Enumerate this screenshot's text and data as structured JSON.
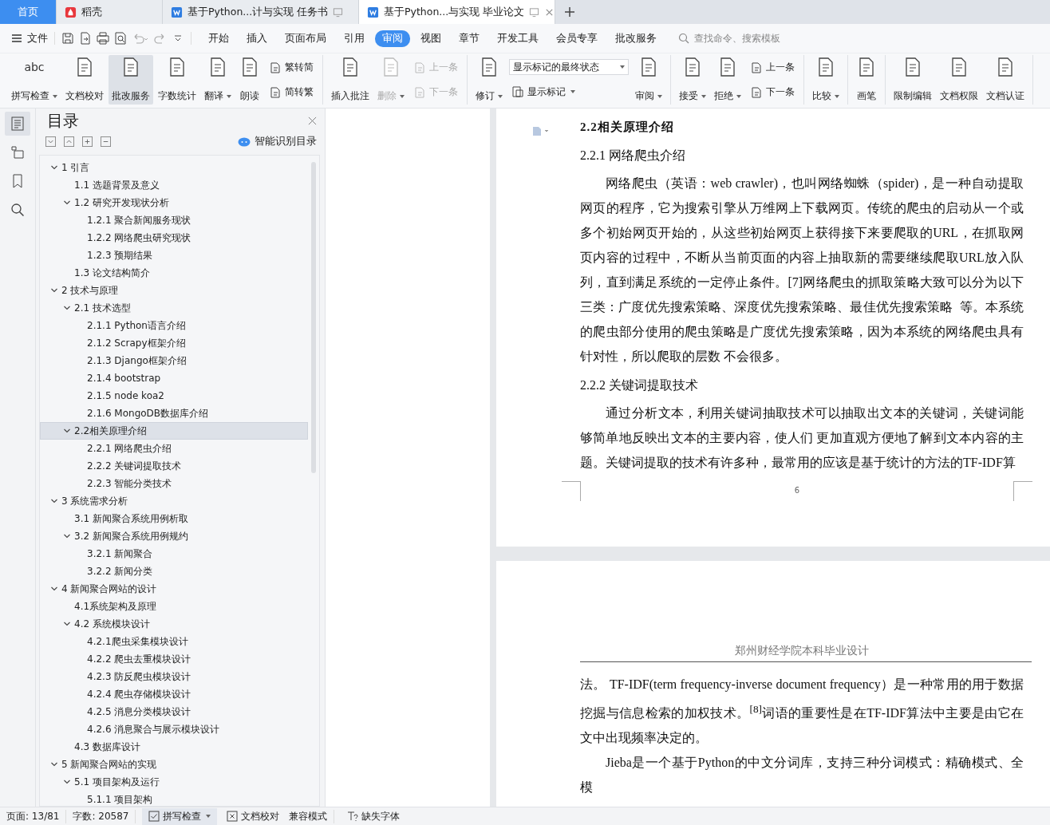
{
  "tabs": [
    {
      "kind": "home",
      "label": "首页",
      "selected": false
    },
    {
      "kind": "app",
      "label": "稻壳",
      "selected": false
    },
    {
      "kind": "doc",
      "label": "基于Python...计与实现 任务书",
      "selected": false
    },
    {
      "kind": "doc",
      "label": "基于Python...与实现 毕业论文",
      "selected": true
    }
  ],
  "menu": {
    "file": "文件",
    "tabs": [
      {
        "label": "开始",
        "selected": false
      },
      {
        "label": "插入",
        "selected": false
      },
      {
        "label": "页面布局",
        "selected": false
      },
      {
        "label": "引用",
        "selected": false
      },
      {
        "label": "审阅",
        "selected": true
      },
      {
        "label": "视图",
        "selected": false
      },
      {
        "label": "章节",
        "selected": false
      },
      {
        "label": "开发工具",
        "selected": false
      },
      {
        "label": "会员专享",
        "selected": false
      },
      {
        "label": "批改服务",
        "selected": false
      }
    ],
    "search": {
      "placeholder": "查找命令、搜索模板"
    }
  },
  "ribbon": [
    [
      {
        "kind": "large",
        "label": "拼写检查",
        "icon_text": "abc",
        "dropdown": true,
        "selected": false,
        "disabled": false
      },
      {
        "kind": "large",
        "label": "文档校对",
        "dropdown": false,
        "selected": false,
        "disabled": false
      },
      {
        "kind": "large",
        "label": "批改服务",
        "dropdown": false,
        "selected": true,
        "disabled": false
      },
      {
        "kind": "large",
        "label": "字数统计",
        "dropdown": false,
        "selected": false,
        "disabled": false
      },
      {
        "kind": "large",
        "label": "翻译",
        "dropdown": true,
        "selected": false,
        "disabled": false
      },
      {
        "kind": "large",
        "label": "朗读",
        "dropdown": false,
        "selected": false,
        "disabled": false
      },
      {
        "kind": "pair",
        "items": [
          {
            "label": "繁转简",
            "disabled": false
          },
          {
            "label": "简转繁",
            "disabled": false
          }
        ]
      }
    ],
    [
      {
        "kind": "large",
        "label": "插入批注",
        "dropdown": false,
        "selected": false,
        "disabled": false
      },
      {
        "kind": "large",
        "label": "删除",
        "dropdown": true,
        "selected": false,
        "disabled": true
      },
      {
        "kind": "pair",
        "items": [
          {
            "label": "上一条",
            "disabled": true
          },
          {
            "label": "下一条",
            "disabled": true
          }
        ]
      }
    ],
    [
      {
        "kind": "large",
        "label": "修订",
        "dropdown": true,
        "selected": false,
        "disabled": false
      },
      {
        "kind": "select",
        "value": "显示标记的最终状态",
        "button": {
          "label": "显示标记",
          "dropdown": true
        }
      },
      {
        "kind": "large",
        "label": "审阅",
        "dropdown": true,
        "selected": false,
        "disabled": false
      }
    ],
    [
      {
        "kind": "large",
        "label": "接受",
        "dropdown": true,
        "selected": false,
        "disabled": false
      },
      {
        "kind": "large",
        "label": "拒绝",
        "dropdown": true,
        "selected": false,
        "disabled": false
      },
      {
        "kind": "pair",
        "items": [
          {
            "label": "上一条",
            "disabled": false
          },
          {
            "label": "下一条",
            "disabled": false
          }
        ]
      }
    ],
    [
      {
        "kind": "large",
        "label": "比较",
        "dropdown": true,
        "selected": false,
        "disabled": false
      }
    ],
    [
      {
        "kind": "large",
        "label": "画笔",
        "dropdown": false,
        "selected": false,
        "disabled": false
      }
    ],
    [
      {
        "kind": "large",
        "label": "限制编辑",
        "dropdown": false,
        "selected": false,
        "disabled": false
      },
      {
        "kind": "large",
        "label": "文档权限",
        "dropdown": false,
        "selected": false,
        "disabled": false
      },
      {
        "kind": "large",
        "label": "文档认证",
        "dropdown": false,
        "selected": false,
        "disabled": false
      }
    ]
  ],
  "rail": [
    {
      "selected": true
    },
    {
      "selected": false
    },
    {
      "selected": false
    },
    {
      "selected": false
    }
  ],
  "toc": {
    "title": "目录",
    "smart_button": "智能识别目录",
    "items": [
      {
        "label": "1 引言",
        "expanded": true,
        "selected": false,
        "children": [
          {
            "label": "1.1 选题背景及意义",
            "selected": false
          },
          {
            "label": "1.2 研究开发现状分析",
            "expanded": true,
            "selected": false,
            "children": [
              {
                "label": "1.2.1 聚合新闻服务现状",
                "selected": false
              },
              {
                "label": "1.2.2 网络爬虫研究现状",
                "selected": false
              },
              {
                "label": "1.2.3 预期结果",
                "selected": false
              }
            ]
          },
          {
            "label": "1.3 论文结构简介",
            "selected": false
          }
        ]
      },
      {
        "label": "2 技术与原理",
        "expanded": true,
        "selected": false,
        "children": [
          {
            "label": "2.1 技术选型",
            "expanded": true,
            "selected": false,
            "children": [
              {
                "label": "2.1.1 Python语言介绍",
                "selected": false
              },
              {
                "label": "2.1.2 Scrapy框架介绍",
                "selected": false
              },
              {
                "label": "2.1.3 Django框架介绍",
                "selected": false
              },
              {
                "label": "2.1.4 bootstrap",
                "selected": false
              },
              {
                "label": "2.1.5 node koa2",
                "selected": false
              },
              {
                "label": "2.1.6 MongoDB数据库介绍",
                "selected": false
              }
            ]
          },
          {
            "label": "2.2相关原理介绍",
            "expanded": true,
            "selected": true,
            "children": [
              {
                "label": "2.2.1 网络爬虫介绍",
                "selected": false
              },
              {
                "label": "2.2.2 关键词提取技术",
                "selected": false
              },
              {
                "label": "2.2.3 智能分类技术",
                "selected": false
              }
            ]
          }
        ]
      },
      {
        "label": "3 系统需求分析",
        "expanded": true,
        "selected": false,
        "children": [
          {
            "label": "3.1 新闻聚合系统用例析取",
            "selected": false
          },
          {
            "label": "3.2 新闻聚合系统用例规约",
            "expanded": true,
            "selected": false,
            "children": [
              {
                "label": "3.2.1 新闻聚合",
                "selected": false
              },
              {
                "label": "3.2.2 新闻分类",
                "selected": false
              }
            ]
          }
        ]
      },
      {
        "label": "4 新闻聚合网站的设计",
        "expanded": true,
        "selected": false,
        "children": [
          {
            "label": "4.1系统架构及原理",
            "selected": false
          },
          {
            "label": "4.2 系统模块设计",
            "expanded": true,
            "selected": false,
            "children": [
              {
                "label": "4.2.1爬虫采集模块设计",
                "selected": false
              },
              {
                "label": "4.2.2 爬虫去重模块设计",
                "selected": false
              },
              {
                "label": "4.2.3 防反爬虫模块设计",
                "selected": false
              },
              {
                "label": "4.2.4 爬虫存储模块设计",
                "selected": false
              },
              {
                "label": "4.2.5 消息分类模块设计",
                "selected": false
              },
              {
                "label": "4.2.6 消息聚合与展示模块设计",
                "selected": false
              }
            ]
          },
          {
            "label": "4.3 数据库设计",
            "selected": false
          }
        ]
      },
      {
        "label": "5 新闻聚合网站的实现",
        "expanded": true,
        "selected": false,
        "children": [
          {
            "label": "5.1 项目架构及运行",
            "expanded": true,
            "selected": false,
            "children": [
              {
                "label": "5.1.1 项目架构",
                "selected": false
              }
            ]
          }
        ]
      }
    ]
  },
  "pages": [
    {
      "blocks": [
        {
          "kind": "section-heading",
          "text": "2.2相关原理介绍"
        },
        {
          "kind": "subheading",
          "text": "2.2.1 网络爬虫介绍"
        },
        {
          "kind": "paragraph",
          "indent": true,
          "text": "网络爬虫（英语：web crawler)，也叫网络蜘蛛（spider)，是一种自动提取网页的程序，它为搜索引擎从万维网上下载网页。传统的爬虫的启动从一个或多个初始网页开始的，从这些初始网页上获得接下来要爬取的URL，在抓取网页内容的过程中，不断从当前页面的内容上抽取新的需要继续爬取URL放入队列，直到满足系统的一定停止条件。[7]网络爬虫的抓取策略大致可以分为以下三类：广度优先搜索策略、深度优先搜索策略、最佳优先搜索策略  等。本系统的爬虫部分使用的爬虫策略是广度优先搜索策略，因为本系统的网络爬虫具有针对性，所以爬取的层数 不会很多。"
        },
        {
          "kind": "subheading",
          "text": "2.2.2 关键词提取技术"
        },
        {
          "kind": "paragraph",
          "indent": true,
          "text": "通过分析文本，利用关键词抽取技术可以抽取出文本的关键词，关键词能够简单地反映出文本的主要内容，使人们 更加直观方便地了解到文本内容的主题。关键词提取的技术有许多种，最常用的应该是基于统计的方法的TF-IDF算"
        }
      ],
      "page_number": "6"
    },
    {
      "header": "郑州财经学院本科毕业设计",
      "blocks": [
        {
          "kind": "paragraph",
          "indent": false,
          "text": "法。 TF-IDF(term frequency-inverse document frequency）是一种常用的用于数据挖掘与信息检索的加权技术。$^{[8]}$词语的重要性是在TF-IDF算法中主要是由它在文中出现频率决定的。"
        },
        {
          "kind": "paragraph",
          "indent": true,
          "text": "Jieba是一个基于Python的中文分词库，支持三种分词模式：精确模式、全模"
        }
      ]
    }
  ],
  "status": [
    {
      "kind": "info",
      "label": "页面: 13/81"
    },
    {
      "kind": "info",
      "label": "字数: 20587"
    },
    {
      "kind": "spell-check",
      "label": "拼写检查",
      "on": true
    },
    {
      "kind": "proofread",
      "label": "文档校对",
      "on": false
    },
    {
      "kind": "info",
      "label": "兼容模式"
    },
    {
      "kind": "missing-font",
      "label": "缺失字体",
      "on": false
    }
  ]
}
